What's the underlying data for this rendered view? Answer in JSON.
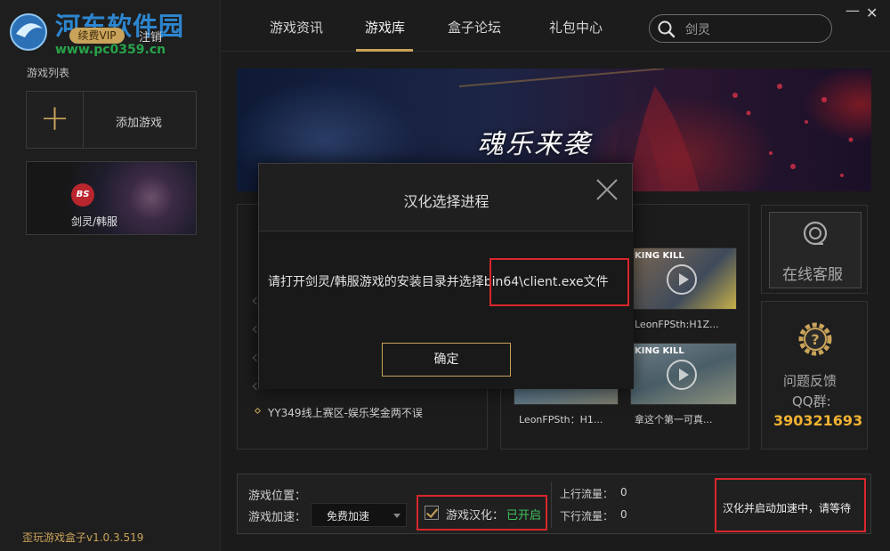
{
  "header": {
    "vip_label": "续费VIP",
    "logout_label": "注销",
    "watermark_title": "河东软件园",
    "watermark_url": "www.pc0359.cn"
  },
  "sidebar": {
    "list_title": "游戏列表",
    "add_game_label": "添加游戏",
    "game_badge": "BS",
    "game_label": "剑灵/韩服",
    "version": "歪玩游戏盒子v1.0.3.519"
  },
  "nav": {
    "tabs": [
      "游戏资讯",
      "游戏库",
      "盒子论坛",
      "礼包中心"
    ],
    "active_tab": "游戏库",
    "search_value": "剑灵"
  },
  "banner": {
    "title": "魂乐来袭"
  },
  "news": {
    "last_item": "YY349线上赛区-娱乐奖金两不误"
  },
  "videos": {
    "thumb_texts": [
      "KING KILL",
      "KING KILL"
    ],
    "captions": [
      "LeonFPSth:H1Z...",
      "LeonFPSth：H1...",
      "拿这个第一可真..."
    ]
  },
  "service": {
    "label": "在线客服"
  },
  "feedback": {
    "title": "问题反馈",
    "qq_label": "QQ群:",
    "qq_number": "390321693"
  },
  "status_panel": {
    "position_label": "游戏位置：",
    "accel_label": "游戏加速：",
    "accel_value": "免费加速",
    "localize_label": "游戏汉化：",
    "localize_status": "已开启",
    "upload_label": "上行流量：",
    "upload_value": "0",
    "download_label": "下行流量：",
    "download_value": "0",
    "status_message": "汉化并启动加速中，请等待"
  },
  "modal": {
    "title": "汉化选择进程",
    "message_prefix": "请打开剑灵/韩服游戏的安装目录并选择",
    "message_path": "bin64\\client.exe文件",
    "ok_label": "确定"
  },
  "colors": {
    "accent_gold": "#c9a35a",
    "highlight_red": "#d9262c",
    "status_green": "#3fc15d",
    "qq_orange": "#f2b233"
  }
}
